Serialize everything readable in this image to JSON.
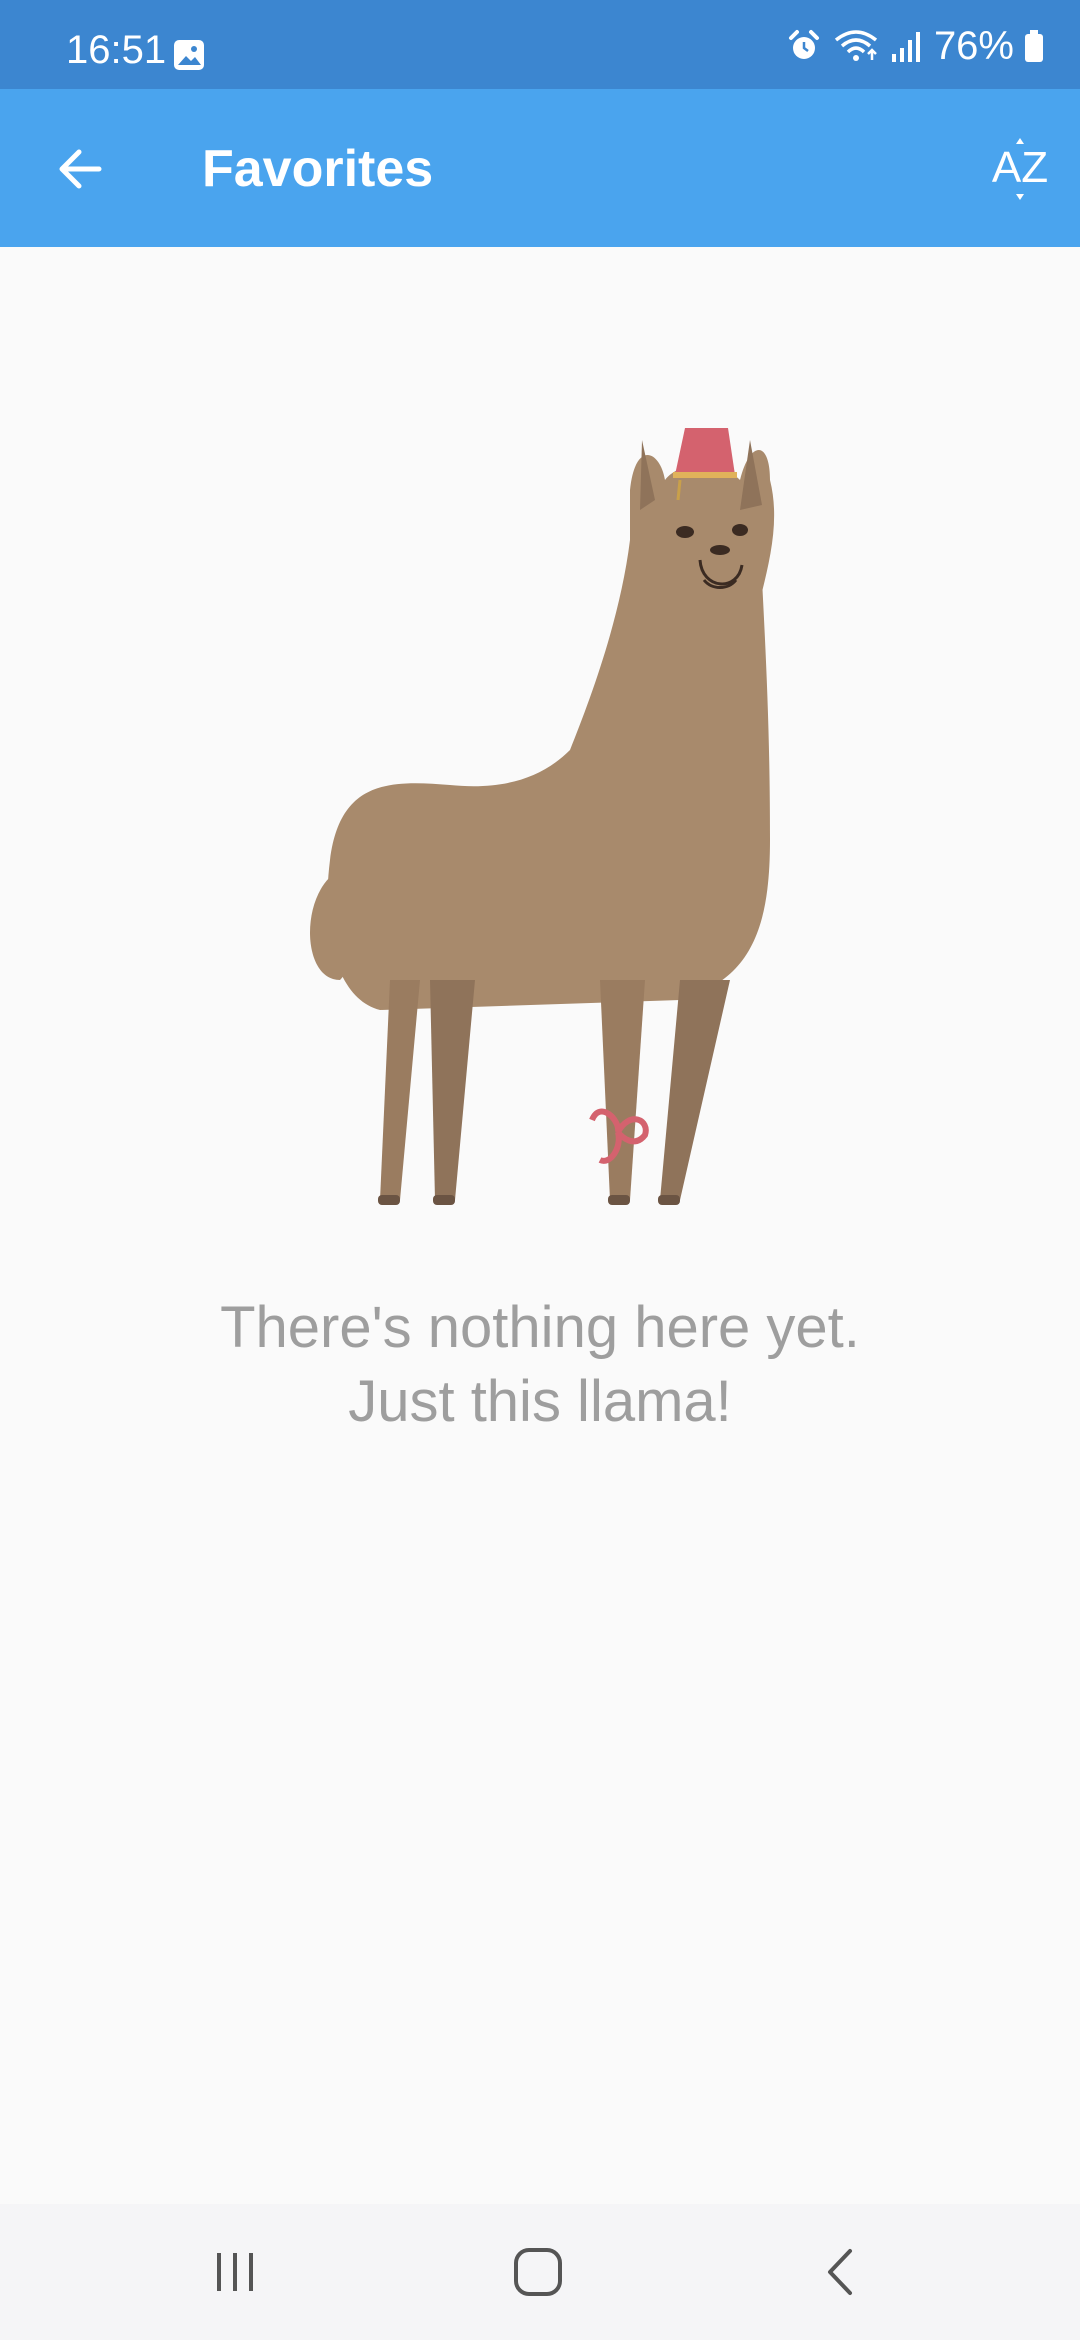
{
  "status_bar": {
    "time": "16:51",
    "battery": "76%",
    "icons": [
      "gallery-icon",
      "alarm-icon",
      "wifi-icon",
      "signal-icon",
      "battery-icon"
    ]
  },
  "app_bar": {
    "title": "Favorites",
    "back_icon": "arrow-left-icon",
    "sort_label": "AZ"
  },
  "empty_state": {
    "line1": "There's nothing here yet.",
    "line2": "Just this llama!",
    "illustration": "llama-illustration"
  },
  "nav_bar": {
    "icons": [
      "recents-icon",
      "home-icon",
      "back-icon"
    ]
  },
  "colors": {
    "status_bar": "#3c86d0",
    "app_bar": "#4aa4ee",
    "background": "#fafafa",
    "empty_text": "#9e9e9e",
    "llama_body": "#a88a6c",
    "fez": "#d4626e"
  }
}
